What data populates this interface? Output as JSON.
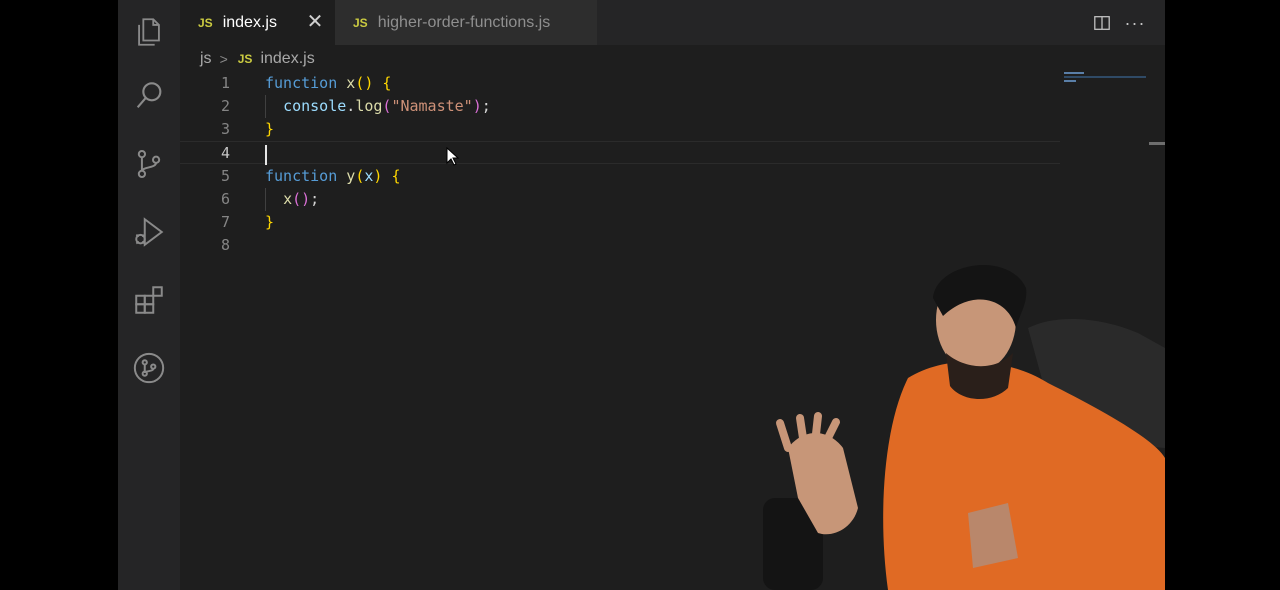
{
  "tabs": [
    {
      "icon": "JS",
      "label": "index.js",
      "active": true
    },
    {
      "icon": "JS",
      "label": "higher-order-functions.js",
      "active": false
    }
  ],
  "breadcrumb": {
    "folder": "js",
    "file_icon": "JS",
    "file": "index.js"
  },
  "editor": {
    "current_line": 4,
    "lines": [
      {
        "num": "1",
        "tokens": [
          "function",
          " ",
          "x",
          "(",
          ")",
          " ",
          "{"
        ]
      },
      {
        "num": "2",
        "tokens": [
          "  ",
          "console",
          ".",
          "log",
          "(",
          "\"Namaste\"",
          ")",
          ";"
        ]
      },
      {
        "num": "3",
        "tokens": [
          "}"
        ]
      },
      {
        "num": "4",
        "tokens": []
      },
      {
        "num": "5",
        "tokens": [
          "function",
          " ",
          "y",
          "(",
          "x",
          ")",
          " ",
          "{"
        ]
      },
      {
        "num": "6",
        "tokens": [
          "  ",
          "x",
          "(",
          ")",
          ";"
        ]
      },
      {
        "num": "7",
        "tokens": [
          "}"
        ]
      },
      {
        "num": "8",
        "tokens": []
      }
    ]
  },
  "activity_bar": [
    "files-icon",
    "search-icon",
    "source-control-icon",
    "run-debug-icon",
    "extensions-icon",
    "git-graph-icon"
  ],
  "colors": {
    "keyword": "#569cd6",
    "function": "#dcdcaa",
    "string": "#ce9178",
    "bracket_outer": "#ffd700",
    "bracket_inner": "#da70d6",
    "js_icon": "#cbcb41"
  }
}
